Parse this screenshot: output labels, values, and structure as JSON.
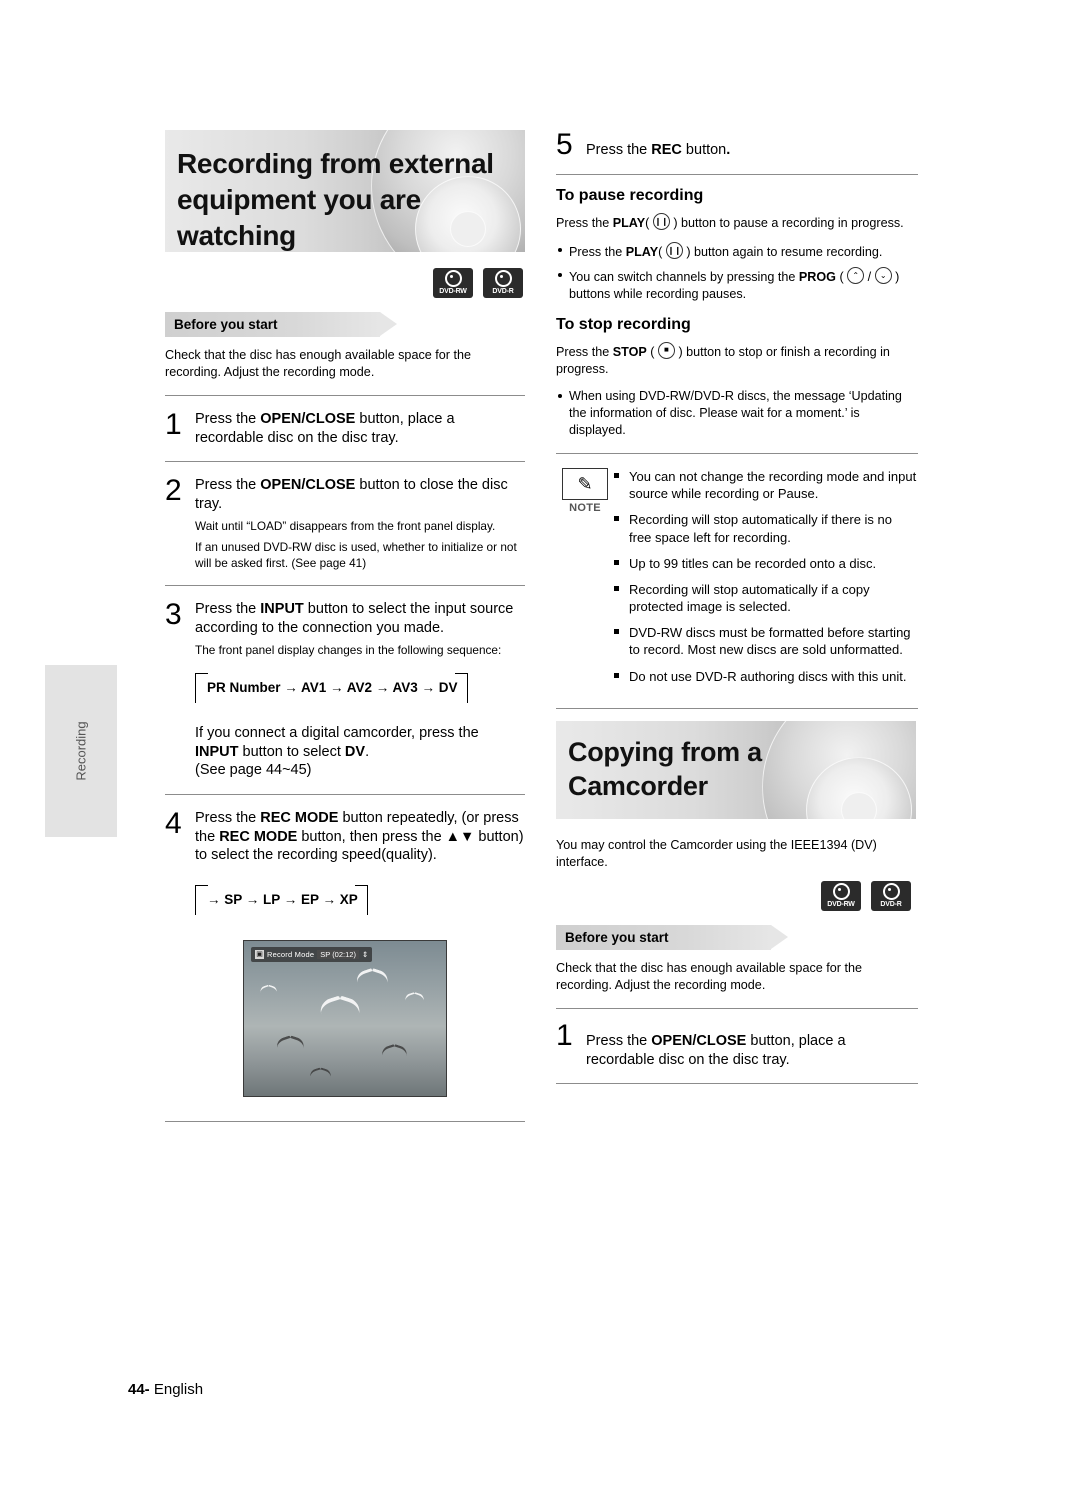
{
  "page": {
    "footer_number": "44-",
    "footer_lang": "English",
    "side_tab": "Recording"
  },
  "left": {
    "title_lines": [
      "Recording from external",
      "equipment you are",
      "watching"
    ],
    "disc_logos": [
      {
        "label": "DVD-RW"
      },
      {
        "label": "DVD-R"
      }
    ],
    "before_you_start": "Before you start",
    "intro": "Check that the disc has enough available space for the recording. Adjust the recording mode.",
    "steps": [
      {
        "num": "1",
        "parts": [
          {
            "t": "Press the ",
            "b": false
          },
          {
            "t": "OPEN/CLOSE",
            "b": true
          },
          {
            "t": " button, place a recordable disc on the disc tray.",
            "b": false
          }
        ],
        "sub": []
      },
      {
        "num": "2",
        "parts": [
          {
            "t": "Press the ",
            "b": false
          },
          {
            "t": "OPEN/CLOSE",
            "b": true
          },
          {
            "t": " button to close the disc tray.",
            "b": false
          }
        ],
        "sub": [
          "Wait until “LOAD” disappears from the front panel display.",
          "If an unused DVD-RW disc is used, whether to initialize or not will be asked first. (See page 41)"
        ]
      },
      {
        "num": "3",
        "parts": [
          {
            "t": "Press the ",
            "b": false
          },
          {
            "t": "INPUT",
            "b": true
          },
          {
            "t": " button to select the input source according to the connection you made.",
            "b": false
          }
        ],
        "sub": [
          "The front panel display changes in the following sequence:"
        ]
      },
      {
        "num": "4",
        "parts": [
          {
            "t": "Press the ",
            "b": false
          },
          {
            "t": "REC MODE",
            "b": true
          },
          {
            "t": " button repeatedly, (or press the ",
            "b": false
          },
          {
            "t": "REC MODE",
            "b": true
          },
          {
            "t": " button, then press the ▲▼ button) to select the recording speed(quality).",
            "b": false
          }
        ],
        "sub": []
      }
    ],
    "sequence_input": "PR Number → AV1 → AV2 → AV3 → DV",
    "sequence_recmode": "→ SP → LP → EP → XP",
    "camcorder_note_parts": [
      {
        "t": "If you connect a digital camcorder, press the ",
        "b": false
      },
      {
        "t": "INPUT",
        "b": true
      },
      {
        "t": " button to select ",
        "b": false
      },
      {
        "t": "DV",
        "b": true
      },
      {
        "t": ". (See page 44~45)",
        "b": false
      }
    ],
    "photo_osd": {
      "icon": "▣",
      "label": "Record Mode",
      "value": "SP (02:12)",
      "arrows": "⇕"
    }
  },
  "right": {
    "step5": {
      "num": "5",
      "parts": [
        {
          "t": "Press the ",
          "b": false
        },
        {
          "t": "REC",
          "b": true
        },
        {
          "t": " button",
          "b": false
        },
        {
          "t": ".",
          "b": true
        }
      ]
    },
    "pause_heading": "To pause recording",
    "pause_intro_parts": [
      {
        "t": "Press the ",
        "b": false
      },
      {
        "t": "PLAY",
        "b": true
      },
      {
        "t": "(",
        "b": false
      },
      {
        "t": "ICON_PLAY",
        "b": false
      },
      {
        "t": ") button to pause a recording in progress.",
        "b": false
      }
    ],
    "pause_bullets": [
      {
        "parts": [
          {
            "t": "Press the ",
            "b": false
          },
          {
            "t": "PLAY",
            "b": true
          },
          {
            "t": "(",
            "b": false
          },
          {
            "t": "ICON_PLAY",
            "b": false
          },
          {
            "t": ") button again to resume recording.",
            "b": false
          }
        ]
      },
      {
        "parts": [
          {
            "t": "You can switch channels by pressing the ",
            "b": false
          },
          {
            "t": "PROG",
            "b": true
          },
          {
            "t": " (",
            "b": false
          },
          {
            "t": "ICON_PROG",
            "b": false
          },
          {
            "t": ") buttons while recording pauses.",
            "b": false
          }
        ]
      }
    ],
    "stop_heading": "To stop recording",
    "stop_intro_parts": [
      {
        "t": "Press the ",
        "b": false
      },
      {
        "t": "STOP",
        "b": true
      },
      {
        "t": " (",
        "b": false
      },
      {
        "t": "ICON_STOP",
        "b": false
      },
      {
        "t": ") button to stop or finish a recording in progress.",
        "b": false
      }
    ],
    "stop_bullets": [
      "When using DVD-RW/DVD-R discs, the message ‘Updating the information of disc. Please wait for a moment.’ is displayed."
    ],
    "note_label": "NOTE",
    "note_items": [
      "You can not change the recording mode and input source while recording or Pause.",
      "Recording will stop automatically if there is no free space left for recording.",
      "Up to 99 titles can be recorded onto a disc.",
      "Recording will stop automatically if a copy protected image is selected.",
      "DVD-RW discs must be formatted before starting to record. Most new discs are sold unformatted.",
      "Do not use DVD-R authoring discs with this unit."
    ],
    "camcorder_title_lines": [
      "Copying from a",
      "Camcorder"
    ],
    "camcorder_intro": "You may control the Camcorder using the IEEE1394 (DV) interface.",
    "disc_logos": [
      {
        "label": "DVD-RW"
      },
      {
        "label": "DVD-R"
      }
    ],
    "before_you_start": "Before you start",
    "before_text": "Check that the disc has enough available space for the recording. Adjust the recording mode.",
    "step1": {
      "num": "1",
      "parts": [
        {
          "t": "Press the ",
          "b": false
        },
        {
          "t": "OPEN/CLOSE",
          "b": true
        },
        {
          "t": " button, place a recordable disc on the disc tray.",
          "b": false
        }
      ]
    }
  }
}
